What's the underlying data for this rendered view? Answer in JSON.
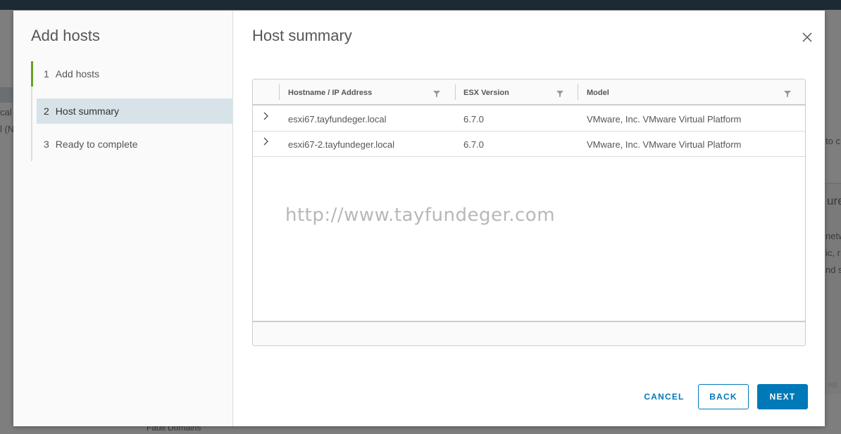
{
  "background": {
    "text_cal": "cal",
    "text_ln": "l (N",
    "text_to": "to c",
    "text_ure": "ure",
    "text_netw": "netw",
    "text_ic": "ic, r",
    "text_nd": "nd s",
    "text_re": "RE",
    "text_fault_domains": "Fault Domains"
  },
  "wizard": {
    "title": "Add hosts",
    "steps": [
      {
        "number": "1",
        "label": "Add hosts",
        "state": "completed"
      },
      {
        "number": "2",
        "label": "Host summary",
        "state": "active"
      },
      {
        "number": "3",
        "label": "Ready to complete",
        "state": "pending"
      }
    ]
  },
  "page": {
    "title": "Host summary"
  },
  "grid": {
    "columns": [
      "Hostname / IP Address",
      "ESX Version",
      "Model"
    ],
    "rows": [
      {
        "hostname": "esxi67.tayfundeger.local",
        "version": "6.7.0",
        "model": "VMware, Inc. VMware Virtual Platform"
      },
      {
        "hostname": "esxi67-2.tayfundeger.local",
        "version": "6.7.0",
        "model": "VMware, Inc. VMware Virtual Platform"
      }
    ]
  },
  "watermark": "http://www.tayfundeger.com",
  "buttons": {
    "cancel": "CANCEL",
    "back": "BACK",
    "next": "NEXT"
  },
  "colors": {
    "accent": "#0079b8",
    "step_complete": "#62a420",
    "active_step_bg": "#d8e3e9"
  },
  "icons": {
    "close": "close-icon",
    "filter": "filter-icon",
    "expand": "chevron-right-icon"
  }
}
